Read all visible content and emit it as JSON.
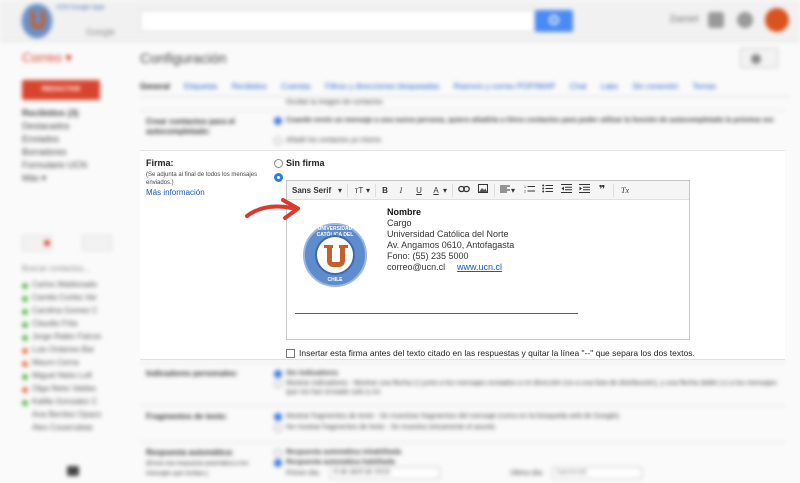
{
  "topbar": {
    "logo_text": "UCN Google Apps",
    "logo_brand": "Google",
    "right_label": "Daniel"
  },
  "sidebar": {
    "app_label": "Correo ▾",
    "compose_label": "REDACTAR",
    "items": [
      {
        "label": "Recibidos (3)",
        "bold": true
      },
      {
        "label": "Destacados",
        "bold": false
      },
      {
        "label": "Enviados",
        "bold": false
      },
      {
        "label": "Borradores",
        "bold": false
      },
      {
        "label": "Formulario UCN",
        "bold": false
      },
      {
        "label": "Más ▾",
        "bold": false
      }
    ],
    "chat_search_placeholder": "Buscar contactos...",
    "contacts": [
      {
        "name": "Carlos Maldonado",
        "status_color": "#55b94a"
      },
      {
        "name": "Camila Cortés Var",
        "status_color": "#55b94a"
      },
      {
        "name": "Carolina Gomez C",
        "status_color": "#55b94a"
      },
      {
        "name": "Claudia Frita",
        "status_color": "#55b94a"
      },
      {
        "name": "Jorge Rabin Falcon",
        "status_color": "#55b94a"
      },
      {
        "name": "Luis Ordenes Bar",
        "status_color": "#e8704b"
      },
      {
        "name": "Mauro Cerna",
        "status_color": "#e8704b"
      },
      {
        "name": "Miguel Nieto Loft",
        "status_color": "#55b94a"
      },
      {
        "name": "Olga Nieto Valdes",
        "status_color": "#e8704b"
      },
      {
        "name": "Kalilla Gonzalez C",
        "status_color": "#55b94a"
      },
      {
        "name": "Ana Benítez Opazo",
        "status_color": "#ffffff"
      },
      {
        "name": "Alex Covarrubias",
        "status_color": "#ffffff"
      }
    ]
  },
  "header": {
    "title": "Configuración"
  },
  "tabs": [
    {
      "label": "General",
      "active": true
    },
    {
      "label": "Etiquetas",
      "active": false
    },
    {
      "label": "Recibidos",
      "active": false
    },
    {
      "label": "Cuentas",
      "active": false
    },
    {
      "label": "Filtros y direcciones bloqueadas",
      "active": false
    },
    {
      "label": "Reenvío y correo POP/IMAP",
      "active": false
    },
    {
      "label": "Chat",
      "active": false
    },
    {
      "label": "Labs",
      "active": false
    },
    {
      "label": "Sin conexión",
      "active": false
    },
    {
      "label": "Temas",
      "active": false
    }
  ],
  "rows": {
    "top_fragment": "Ocultar la imagen de contactos",
    "contacts_label": "Crear contactos para el autocompletado:",
    "contacts_opt1": "Cuando envío un mensaje a una nueva persona, quiero añadirla a Otros contactos para poder utilizar la función de autocompletado la próxima vez",
    "contacts_opt2": "Añadir los contactos yo mismo",
    "importance_label": "Indicadores personales:",
    "importance_opt1": "Sin indicadores",
    "importance_opt2": "Mostrar indicadores - Mostrar una flecha (›) junto a los mensajes enviados a mi dirección (no a una lista de distribución), y una flecha doble (») a los mensajes que me han enviado solo a mí.",
    "snippets_label": "Fragmentos de texto:",
    "snippets_opt1": "Mostrar fragmentos de texto - Se muestran fragmentos del mensaje (como en la búsqueda web de Google).",
    "snippets_opt2": "No mostrar fragmentos de texto - Se muestra únicamente el asunto.",
    "vacation_label": "Respuesta automática:",
    "vacation_note": "(Envía una respuesta automática a los mensajes que recibas.)",
    "vacation_opt1": "Respuesta automática inhabilitada",
    "vacation_opt2": "Respuesta automática habilitada",
    "vacation_first_day": "Primer día:",
    "vacation_date": "6 de abril de 2015",
    "vacation_last_day": "Último día:",
    "vacation_optional": "(opcional)"
  },
  "firma": {
    "label": "Firma:",
    "note": "(Se adjunta al final de todos los mensajes enviados.)",
    "more_info": "Más información",
    "no_signature": "Sin firma",
    "toolbar": {
      "font": "Sans Serif",
      "size": "тT",
      "bold": "B",
      "italic": "I",
      "underline": "U",
      "text_color": "A",
      "quote": "❞",
      "clear": "Tx"
    },
    "signature": {
      "seal_top": "UNIVERSIDAD CATÓLICA DEL NORTE",
      "seal_bottom": "CHILE",
      "name": "Nombre",
      "position": "Cargo",
      "university": "Universidad Católica del Norte",
      "address": "Av. Angamos 0610, Antofagasta",
      "phone": "Fono: (55) 235 5000",
      "email": "correo@ucn.cl",
      "website": "www.ucn.cl"
    },
    "checkbox_label": "Insertar esta firma antes del texto citado en las respuestas y quitar la línea \"--\" que separa los dos textos."
  },
  "colors": {
    "accent_blue": "#2f7de1",
    "compose_red": "#d9442e",
    "arrow_red": "#d93a2b",
    "ucn_orange": "#c4612a",
    "ucn_blue": "#3d69ad"
  }
}
